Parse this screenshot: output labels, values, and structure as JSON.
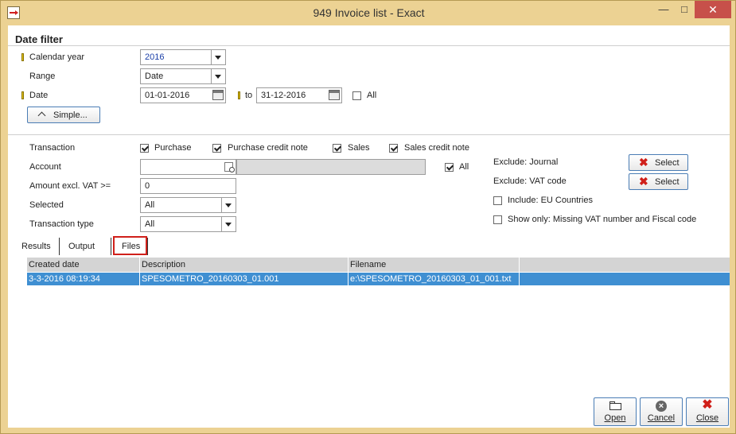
{
  "window": {
    "title": "949 Invoice list - Exact",
    "min_glyph": "—",
    "max_glyph": "□",
    "close_glyph": "✕"
  },
  "date_filter": {
    "section_title": "Date filter",
    "calendar_year_label": "Calendar year",
    "calendar_year_value": "2016",
    "range_label": "Range",
    "range_value": "Date",
    "date_label": "Date",
    "date_from": "01-01-2016",
    "to_label": "to",
    "date_to": "31-12-2016",
    "all_label": "All",
    "simple_button": "Simple..."
  },
  "filters": {
    "transaction_label": "Transaction",
    "purchase_label": "Purchase",
    "purchase_credit_note_label": "Purchase credit note",
    "sales_label": "Sales",
    "sales_credit_note_label": "Sales credit note",
    "account_label": "Account",
    "account_value": "",
    "account_all_label": "All",
    "amount_label": "Amount excl. VAT >=",
    "amount_value": "0",
    "selected_label": "Selected",
    "selected_value": "All",
    "transaction_type_label": "Transaction type",
    "transaction_type_value": "All",
    "exclude_journal_label": "Exclude: Journal",
    "exclude_vat_label": "Exclude: VAT code",
    "select_button": "Select",
    "include_eu_label": "Include: EU Countries",
    "show_only_label": "Show only: Missing VAT number and Fiscal code"
  },
  "tabs": [
    {
      "label": "Results"
    },
    {
      "label": "Output"
    },
    {
      "label": "Files"
    }
  ],
  "grid": {
    "columns": [
      "Created date",
      "Description",
      "Filename"
    ],
    "rows": [
      {
        "created": "3-3-2016 08:19:34",
        "description": "SPESOMETRO_20160303_01.001",
        "filename": "e:\\SPESOMETRO_20160303_01_001.txt"
      }
    ]
  },
  "footer": {
    "open": "Open",
    "cancel": "Cancel",
    "close": "Close"
  },
  "colors": {
    "accent": "#3f8fd2",
    "frame": "#ecd293",
    "close_red": "#d0201a"
  }
}
